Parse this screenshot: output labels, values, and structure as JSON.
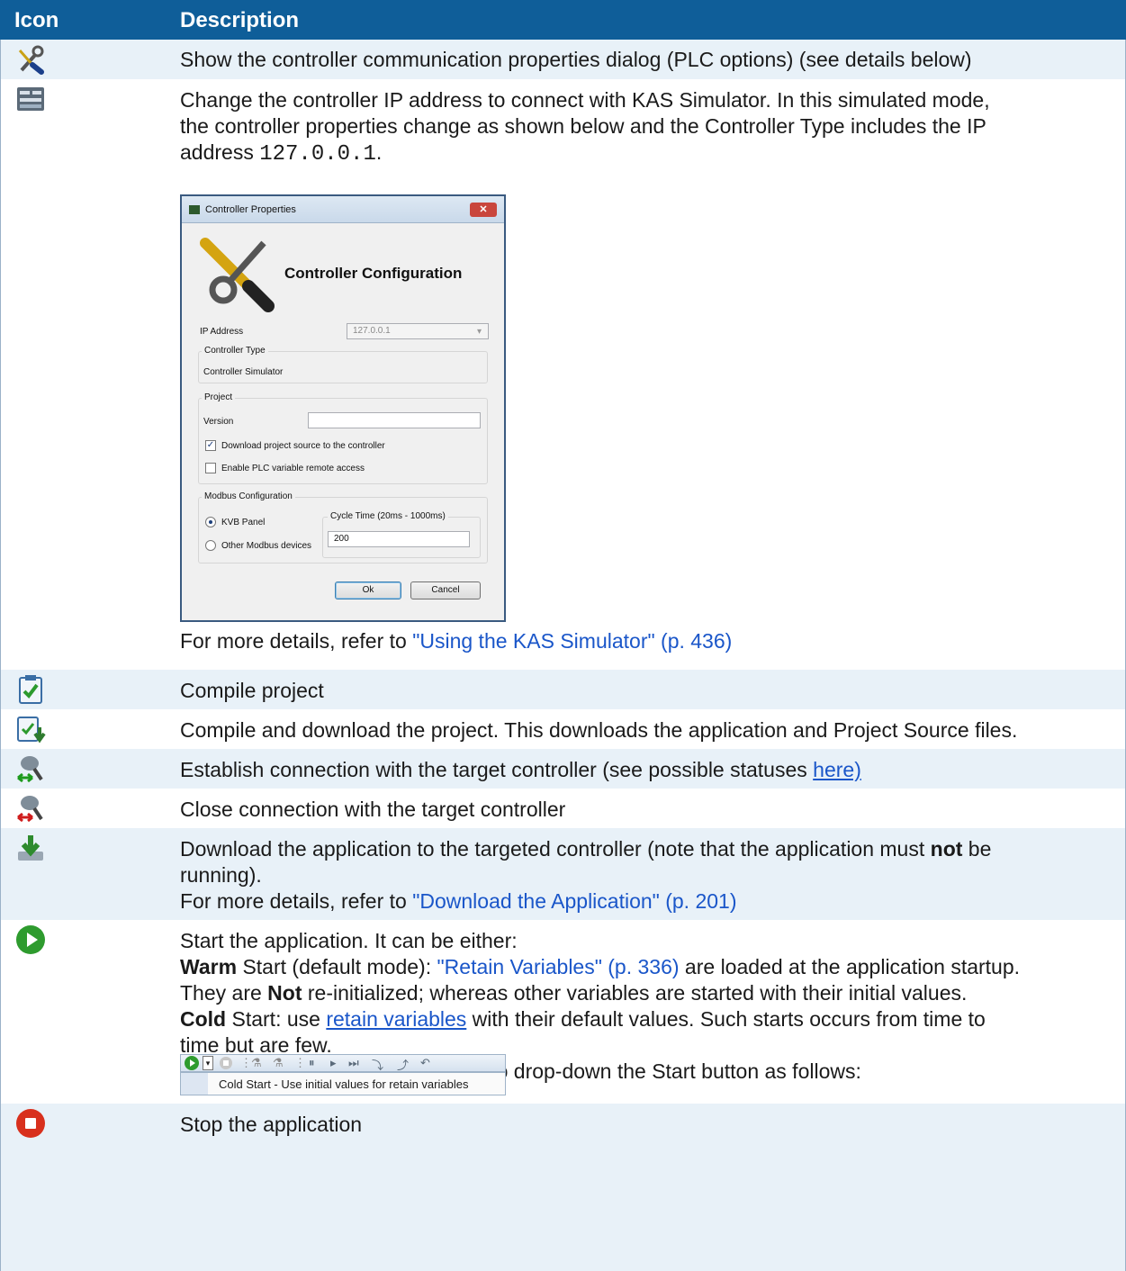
{
  "header": {
    "col_icon": "Icon",
    "col_description": "Description"
  },
  "rows": {
    "r1": {
      "text": "Show the controller communication properties dialog (PLC options) (see details below)"
    },
    "r2": {
      "text_line1": "Change the controller IP address to connect with KAS Simulator. In this simulated mode,",
      "text_line2": "the controller properties change as shown below and the Controller Type includes the IP",
      "text_line3_pre": "address ",
      "text_line3_code": "127.0.0.1",
      "text_line3_post": ".",
      "more_pre": "For more details, refer to ",
      "more_link": "\"Using the KAS Simulator\" (p. 436)"
    },
    "r3": {
      "text": "Compile project"
    },
    "r4": {
      "text": "Compile and download the project. This downloads the application and Project Source files."
    },
    "r5": {
      "text_pre": "Establish connection with the target controller (see possible statuses ",
      "link": "here)"
    },
    "r6": {
      "text": "Close connection with the target controller"
    },
    "r7": {
      "line1_pre": "Download the application to the targeted controller (note that the application must ",
      "line1_bold": "not",
      "line1_post": " be",
      "line2": "running).",
      "more_pre": "For more details, refer to ",
      "more_link": "\"Download the Application\" (p. 201)"
    },
    "r8": {
      "line1": "Start the application. It can be either:",
      "warm_bold": "Warm",
      "warm_pre": " Start (default mode): ",
      "warm_link": "\"Retain Variables\" (p. 336)",
      "warm_post": " are loaded at the application startup.",
      "line3_pre": "They are ",
      "line3_bold": "Not",
      "line3_post": " re-initialized; whereas other variables are started with their initial values.",
      "cold_bold": "Cold",
      "cold_pre": " Start: use ",
      "cold_link": "retain variables",
      "cold_post": " with their default values. Such starts occurs from time to",
      "line5": "time but are few.",
      "line6": "To choose a Cold Start, you have to drop-down the Start button as follows:",
      "menu_item": "Cold Start - Use initial values for retain variables"
    },
    "r9": {
      "text": "Stop the application"
    }
  },
  "dialog": {
    "title": "Controller Properties",
    "heading": "Controller Configuration",
    "ip_label": "IP Address",
    "ip_value": "127.0.0.1",
    "type_group": "Controller Type",
    "type_value": "Controller Simulator",
    "project_group": "Project",
    "version_label": "Version",
    "version_value": "",
    "download_source_label": "Download project source to the controller",
    "download_source_checked": true,
    "remote_access_label": "Enable PLC variable remote access",
    "remote_access_checked": false,
    "modbus_group": "Modbus Configuration",
    "kvb_label": "KVB Panel",
    "other_label": "Other Modbus devices",
    "cycle_group": "Cycle Time (20ms - 1000ms)",
    "cycle_value": "200",
    "ok_label": "Ok",
    "cancel_label": "Cancel",
    "close_glyph": "✕"
  },
  "colors": {
    "header_bg": "#0f5e99",
    "row_alt_bg": "#e8f1f8",
    "link": "#1a56c9"
  }
}
